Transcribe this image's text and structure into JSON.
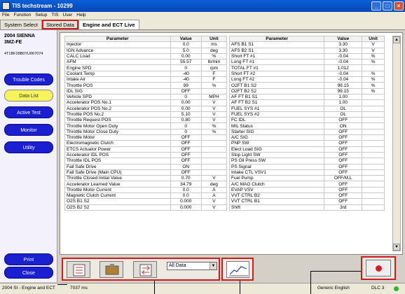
{
  "window": {
    "title": "TIS techstream - 10299",
    "min": "_",
    "max": "□",
    "close": "×"
  },
  "menu": [
    "File",
    "Function",
    "Setup",
    "TIS",
    "User",
    "Help"
  ],
  "tabs": [
    "System Select",
    "Stored Data",
    "Engine and ECT Live"
  ],
  "vehicle": {
    "model": "2004 SIENNA",
    "engine": "3MZ-FE",
    "vin": "4T1BF28B0YU067074"
  },
  "nav": [
    "Trouble Codes",
    "Data List",
    "Active Test",
    "Monitor",
    "Utility"
  ],
  "bottom_buttons": {
    "print": "Print",
    "close": "Close"
  },
  "table_headers": {
    "param": "Parameter",
    "value": "Value",
    "unit": "Unit"
  },
  "left_rows": [
    [
      "Injector",
      "0.0",
      "ms"
    ],
    [
      "IGN Advance",
      "5.0",
      "deg"
    ],
    [
      "CALC Load",
      "0.00",
      "%"
    ],
    [
      "AFM",
      "55.57",
      "lb/min"
    ],
    [
      "Engine SPD",
      "0",
      "rpm"
    ],
    [
      "Coolant Temp",
      "-40",
      "F"
    ],
    [
      "Intake Air",
      "-40",
      "F"
    ],
    [
      "Throttle POS",
      "99",
      "%"
    ],
    [
      "IDL SIG",
      "OFF",
      ""
    ],
    [
      "Vehicle SPD",
      "0",
      "MPH"
    ],
    [
      "Accelerator POS No.1",
      "0.00",
      "V"
    ],
    [
      "Accelerator POS No.2",
      "0.00",
      "V"
    ],
    [
      "Throttle POS No.2",
      "5.10",
      "V"
    ],
    [
      "Throttle Request POS",
      "0.80",
      "V"
    ],
    [
      "Throttle Motor Open Duty",
      "0",
      "%"
    ],
    [
      "Throttle Motor Close Duty",
      "0",
      "%"
    ],
    [
      "Throttle Motor",
      "OFF",
      ""
    ],
    [
      "Electromagnetic Clutch",
      "OFF",
      ""
    ],
    [
      "ETCS Actuator Power",
      "OFF",
      ""
    ],
    [
      "Accelerator  IDL POS",
      "OFF",
      ""
    ],
    [
      "Throttle IDL POS",
      "OFF",
      ""
    ],
    [
      "Fail Safe Drive",
      "ON",
      ""
    ],
    [
      "Fail Safe Drive (Main CPU)",
      "OFF",
      ""
    ],
    [
      "Throttle Closed Initial Value",
      "0.70",
      "V"
    ],
    [
      "Accelerator Learned Value",
      "34.79",
      "deg"
    ],
    [
      "Throttle Motor Current",
      "0.0",
      "A"
    ],
    [
      "Magnetic Clutch Current",
      "0.0",
      "A"
    ],
    [
      "O2S B1 S2",
      "0.000",
      "V"
    ],
    [
      "O2S B2 S2",
      "0.000",
      "V"
    ]
  ],
  "right_rows": [
    [
      "AFS B1 S1",
      "3.30",
      "V"
    ],
    [
      "AFS B2 S1",
      "3.30",
      "V"
    ],
    [
      "Short FT #1",
      "-0.04",
      "%"
    ],
    [
      "Long FT #1",
      "-0.04",
      "%"
    ],
    [
      "TOTAL FT #1",
      "1.012",
      ""
    ],
    [
      "Short FT #2",
      "-0.04",
      "%"
    ],
    [
      "Long FT #2",
      "-0.04",
      "%"
    ],
    [
      "O2FT B1 S2",
      "99.15",
      "%"
    ],
    [
      "O2FT B2 S2",
      "99.15",
      "%"
    ],
    [
      "AF FT B1 S1",
      "1.00",
      ""
    ],
    [
      "AF FT B2 S1",
      "1.00",
      ""
    ],
    [
      "FUEL SYS #1",
      "OL",
      ""
    ],
    [
      "FUEL SYS #2",
      "OL",
      ""
    ],
    [
      "FC IDL",
      "OFF",
      ""
    ],
    [
      "MIL Status",
      "ON",
      ""
    ],
    [
      "Starter SIG",
      "OFF",
      ""
    ],
    [
      "A/C SIG",
      "OFF",
      ""
    ],
    [
      "PNP SW",
      "OFF",
      ""
    ],
    [
      "Elect Load SIG",
      "OFF",
      ""
    ],
    [
      "Stop Light SW",
      "OFF",
      ""
    ],
    [
      "PS Oil Press SW",
      "OFF",
      ""
    ],
    [
      "PS Signal",
      "OFF",
      ""
    ],
    [
      "Intake CTL VSV1",
      "OFF",
      ""
    ],
    [
      "Fuel Pump",
      "OFF/M,L",
      ""
    ],
    [
      "A/C MAG Clutch",
      "OFF",
      ""
    ],
    [
      "EVAP VSV",
      "OFF",
      ""
    ],
    [
      "VVT CTRL B2",
      "OFF",
      ""
    ],
    [
      "VVT CTRL B1",
      "OFF",
      ""
    ],
    [
      "Shift",
      "3rd",
      ""
    ]
  ],
  "filter": {
    "selected": "All Data"
  },
  "status": {
    "left": "2004 SI - Engine and ECT",
    "time": "7037 ms",
    "lang": "Generic English",
    "dlc": "DLC 3"
  },
  "colors": {
    "nav_blue": "#1a1fd0",
    "nav_selected": "#f6f45a",
    "highlight": "#d41b1b"
  }
}
